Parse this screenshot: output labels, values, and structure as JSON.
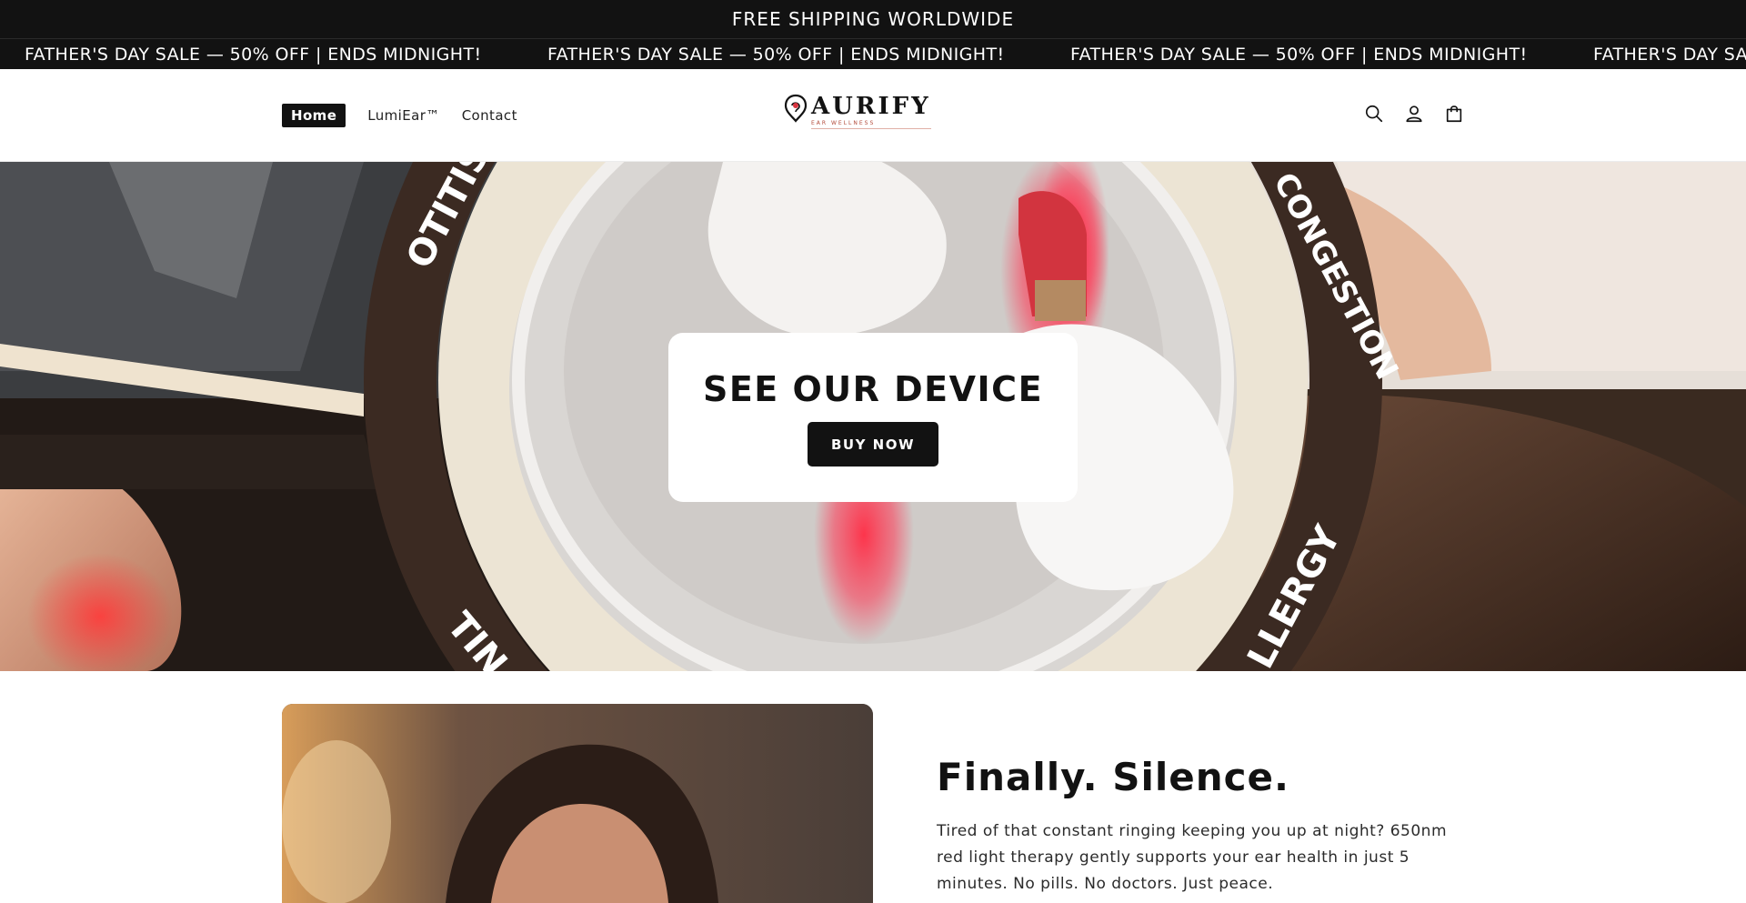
{
  "announcement": {
    "shipping_text": "FREE SHIPPING WORLDWIDE",
    "sale_text": "FATHER'S DAY SALE — 50% OFF | ENDS MIDNIGHT!"
  },
  "header": {
    "nav": [
      {
        "label": "Home",
        "active": true
      },
      {
        "label": "LumiEar™",
        "active": false
      },
      {
        "label": "Contact",
        "active": false
      }
    ],
    "logo": {
      "word": "AURIFY",
      "tagline": "EAR WELLNESS"
    },
    "icons": [
      "search-icon",
      "account-icon",
      "cart-icon"
    ]
  },
  "hero": {
    "title": "SEE OUR DEVICE",
    "button_label": "BUY NOW",
    "ring_labels": [
      "OTITIS M",
      "CONGESTION",
      "TIN",
      "LLERGY"
    ]
  },
  "feature": {
    "title": "Finally. Silence.",
    "body": "Tired of that constant ringing keeping you up at night? 650nm red light therapy gently supports your ear health in just 5 minutes. No pills. No doctors. Just peace."
  },
  "colors": {
    "bar_bg": "#121212",
    "accent_red": "#e6253a",
    "ring_brown": "#3b2a22",
    "cream": "#ece4d4"
  }
}
